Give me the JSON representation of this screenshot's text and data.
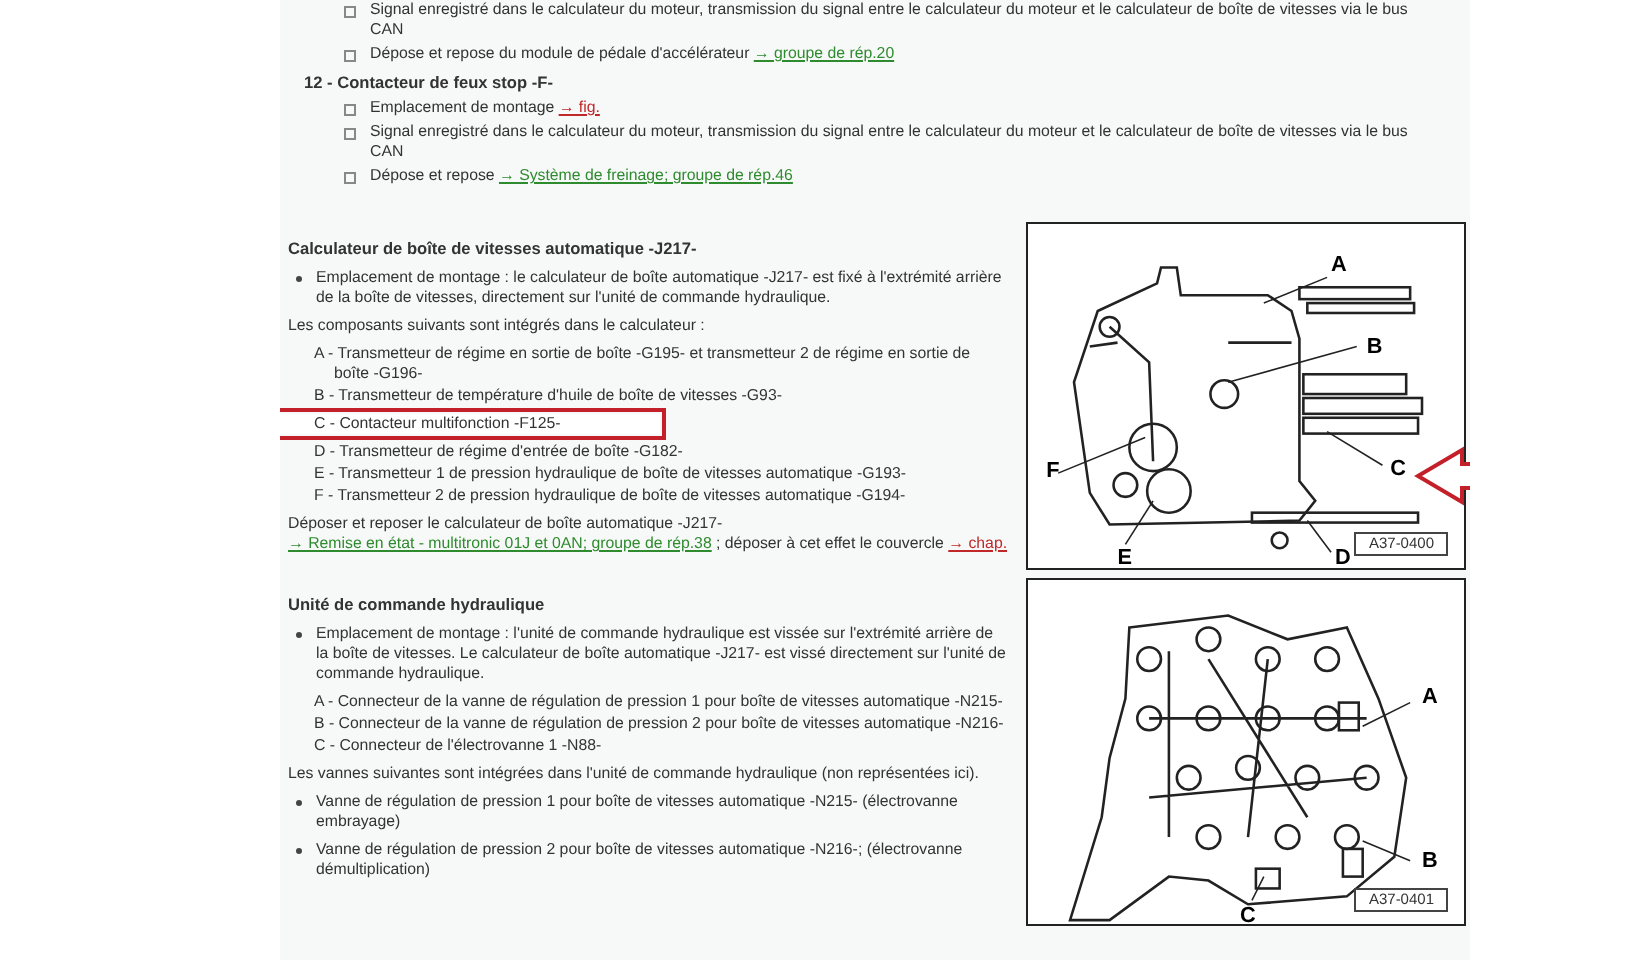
{
  "top_section": {
    "items": [
      {
        "parts": [
          {
            "kind": "text",
            "text": "Signal enregistré dans le calculateur du moteur, transmission du signal entre le calculateur du moteur et le calculateur de boîte de vitesses via le bus CAN"
          }
        ]
      },
      {
        "parts": [
          {
            "kind": "text",
            "text": "Dépose et repose du module de pédale d'accélérateur "
          },
          {
            "kind": "link_green",
            "text": "→ groupe de rép.20"
          }
        ]
      }
    ],
    "numbered": {
      "title": "12 - Contacteur de feux stop -F-",
      "items": [
        {
          "parts": [
            {
              "kind": "text",
              "text": "Emplacement de montage "
            },
            {
              "kind": "link_red",
              "text": "→ fig."
            }
          ]
        },
        {
          "parts": [
            {
              "kind": "text",
              "text": "Signal enregistré dans le calculateur du moteur, transmission du signal entre le calculateur du moteur et le calculateur de boîte de vitesses via le bus CAN"
            }
          ]
        },
        {
          "parts": [
            {
              "kind": "text",
              "text": "Dépose et repose "
            },
            {
              "kind": "link_green",
              "text": "→ Système de freinage; groupe de rép.46"
            }
          ]
        }
      ]
    }
  },
  "sections": [
    {
      "heading": "Calculateur de boîte de vitesses automatique -J217-",
      "blocks": [
        {
          "kind": "bullet",
          "parts": [
            {
              "kind": "text",
              "text": "Emplacement de montage : le calculateur de boîte automatique -J217- est fixé à l'extrémité arrière de la boîte de vitesses, directement sur l'unité de commande hydraulique."
            }
          ]
        },
        {
          "kind": "paragraph",
          "parts": [
            {
              "kind": "text",
              "text": "Les composants suivants sont intégrés dans le calculateur :"
            }
          ]
        },
        {
          "kind": "lettered",
          "items": [
            {
              "text": "A - Transmetteur de régime en sortie de boîte -G195- et transmetteur 2 de régime en sortie de boîte -G196-",
              "highlighted": false
            },
            {
              "text": "B - Transmetteur de température d'huile de boîte de vitesses -G93-",
              "highlighted": false
            },
            {
              "text": "C - Contacteur multifonction -F125-",
              "highlighted": true
            },
            {
              "text": "D - Transmetteur de régime d'entrée de boîte -G182-",
              "highlighted": false
            },
            {
              "text": "E - Transmetteur 1 de pression hydraulique de boîte de vitesses automatique -G193-",
              "highlighted": false
            },
            {
              "text": "F - Transmetteur 2 de pression hydraulique de boîte de vitesses automatique -G194-",
              "highlighted": false
            }
          ]
        },
        {
          "kind": "paragraph",
          "parts": [
            {
              "kind": "text",
              "text": "Déposer et reposer le calculateur de boîte automatique -J217- "
            },
            {
              "kind": "link_green",
              "text": "→ Remise en état - multitronic 01J et 0AN; groupe de rép.38"
            },
            {
              "kind": "text",
              "text": " ; déposer à cet effet le couvercle "
            },
            {
              "kind": "link_red",
              "text": "→ chap."
            }
          ]
        }
      ],
      "figure": {
        "kind": "controller",
        "code": "A37-0400",
        "labels": [
          "A",
          "B",
          "F",
          "C",
          "E",
          "D"
        ],
        "callout_arrow": true
      }
    },
    {
      "heading": "Unité de commande hydraulique",
      "blocks": [
        {
          "kind": "bullet",
          "parts": [
            {
              "kind": "text",
              "text": "Emplacement de montage : l'unité de commande hydraulique est vissée sur l'extrémité arrière de la boîte de vitesses. Le calculateur de boîte automatique -J217- est vissé directement sur l'unité de commande hydraulique."
            }
          ]
        },
        {
          "kind": "lettered",
          "items": [
            {
              "text": "A - Connecteur de la vanne de régulation de pression 1 pour boîte de vitesses automatique -N215-",
              "highlighted": false
            },
            {
              "text": "B - Connecteur de la vanne de régulation de pression 2 pour boîte de vitesses automatique -N216-",
              "highlighted": false
            },
            {
              "text": "C - Connecteur de l'électrovanne 1 -N88-",
              "highlighted": false
            }
          ]
        },
        {
          "kind": "paragraph",
          "parts": [
            {
              "kind": "text",
              "text": "Les vannes suivantes sont intégrées dans l'unité de commande hydraulique (non représentées ici)."
            }
          ]
        },
        {
          "kind": "bullet",
          "parts": [
            {
              "kind": "text",
              "text": "Vanne de régulation de pression 1 pour boîte de vitesses automatique -N215- (électrovanne embrayage)"
            }
          ]
        },
        {
          "kind": "bullet",
          "parts": [
            {
              "kind": "text",
              "text": "Vanne de régulation de pression 2 pour boîte de vitesses automatique -N216-; (électrovanne démultiplication)"
            }
          ]
        }
      ],
      "figure": {
        "kind": "valve_body",
        "code": "A37-0401",
        "labels": [
          "A",
          "B",
          "C"
        ],
        "callout_arrow": false
      }
    }
  ]
}
